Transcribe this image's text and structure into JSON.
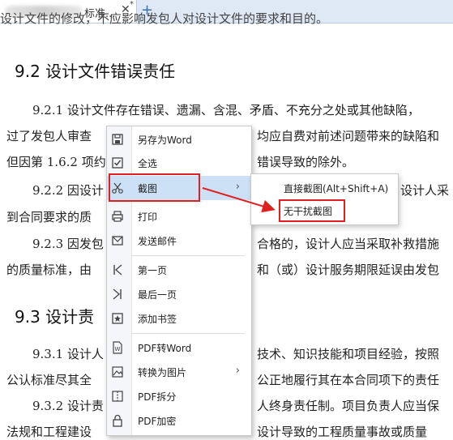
{
  "tab": {
    "title": "标准...",
    "close": "✕",
    "modified": "*",
    "new_tab": "+"
  },
  "doc": {
    "lines": [
      "设计文件的修改，不应影响发包人对设计文件的要求和目的。",
      "9.2.1  设计文件存在错误、遗漏、含混、矛盾、不充分之处或其他缺陷，",
      "过了发包人审查",
      "均应自费对前述问题带来的缺陷和",
      "但因第 1.6.2 项约",
      "错误导致的除外。",
      "9.2.2  因设计",
      "设计人采",
      "到合同要求的质",
      "9.2.3  因发包",
      "合格的，设计人应当采取补救措施",
      "的质量标准，由",
      "和（或）设计服务期限延误由发包",
      "9.3.1  设计人",
      "技术、知识技能和项目经验，按照",
      "公认标准尽其全",
      "公正地履行其在本合同项下的责任",
      "9.3.2  设计责",
      "人终身责任制。项目负责人应当保",
      "法规和工程建设",
      "设计导致的工程质量事故或质量"
    ],
    "heading_92": "9.2  设计文件错误责任",
    "heading_93": "9.3  设计责"
  },
  "menu": {
    "items": [
      {
        "label": "另存为Word",
        "icon": "save-icon"
      },
      {
        "label": "全选",
        "icon": "select-all-icon"
      },
      {
        "label": "截图",
        "icon": "scissors-icon",
        "arrow": "›"
      },
      {
        "label": "打印",
        "icon": "printer-icon"
      },
      {
        "label": "发送邮件",
        "icon": "mail-icon"
      },
      {
        "label": "第一页",
        "icon": "first-page-icon"
      },
      {
        "label": "最后一页",
        "icon": "last-page-icon"
      },
      {
        "label": "添加书签",
        "icon": "bookmark-icon"
      },
      {
        "label": "PDF转Word",
        "icon": "pdf-to-word-icon"
      },
      {
        "label": "转换为图片",
        "icon": "convert-image-icon",
        "arrow": "›"
      },
      {
        "label": "PDF拆分",
        "icon": "pdf-split-icon"
      },
      {
        "label": "PDF加密",
        "icon": "lock-icon"
      }
    ]
  },
  "submenu": {
    "items": [
      {
        "label": "直接截图(Alt+Shift+A)"
      },
      {
        "label": "无干扰截图"
      }
    ]
  },
  "colors": {
    "highlight": "#cce0f6",
    "annotation": "#e02020",
    "tabbar": "#dfe9f5"
  }
}
